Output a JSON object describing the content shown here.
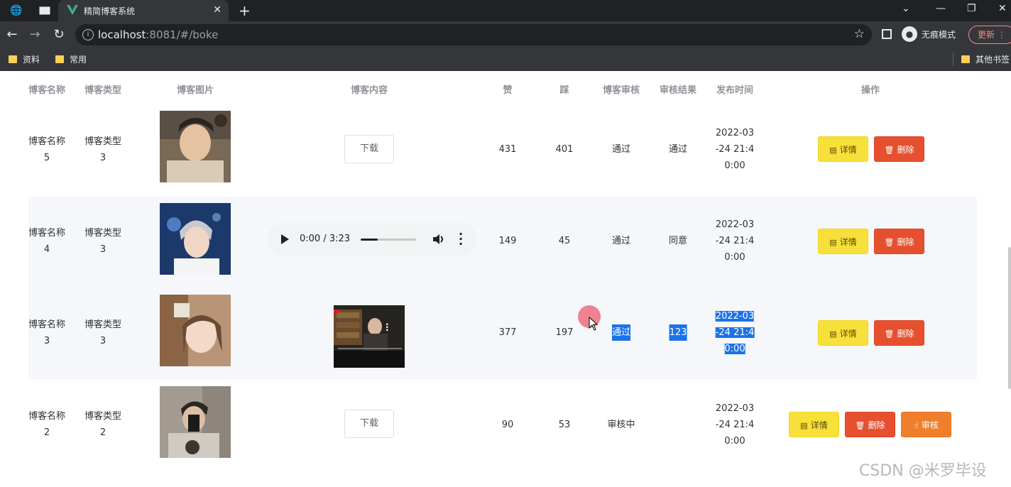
{
  "browser": {
    "tab_title": "精简博客系统",
    "url_host": "localhost",
    "url_rest": ":8081/#/boke",
    "incognito_label": "无痕模式",
    "update_label": "更新",
    "bookmarks": [
      "资料",
      "常用"
    ],
    "other_bookmarks": "其他书签"
  },
  "table": {
    "headers": [
      "博客名称",
      "博客类型",
      "博客图片",
      "博客内容",
      "赞",
      "踩",
      "博客审核",
      "审核结果",
      "发布时间",
      "操作"
    ],
    "rows": [
      {
        "name_line1": "博客名称",
        "name_line2": "5",
        "type_line1": "博客类型",
        "type_line2": "3",
        "content_kind": "download",
        "download_label": "下载",
        "likes": "431",
        "dislikes": "401",
        "review": "通过",
        "result": "通过",
        "time_l1": "2022-03",
        "time_l2": "-24 21:4",
        "time_l3": "0:00",
        "detail_label": "详情",
        "delete_label": "删除"
      },
      {
        "name_line1": "博客名称",
        "name_line2": "4",
        "type_line1": "博客类型",
        "type_line2": "3",
        "content_kind": "audio",
        "audio_time": "0:00 / 3:23",
        "audio_progress": 0.31,
        "likes": "149",
        "dislikes": "45",
        "review": "通过",
        "result": "同意",
        "time_l1": "2022-03",
        "time_l2": "-24 21:4",
        "time_l3": "0:00",
        "detail_label": "详情",
        "delete_label": "删除"
      },
      {
        "name_line1": "博客名称",
        "name_line2": "3",
        "type_line1": "博客类型",
        "type_line2": "3",
        "content_kind": "video",
        "likes": "377",
        "dislikes": "197",
        "review": "通过",
        "result": "123",
        "time_l1": "2022-03",
        "time_l2": "-24 21:4",
        "time_l3": "0:00",
        "detail_label": "详情",
        "delete_label": "删除"
      },
      {
        "name_line1": "博客名称",
        "name_line2": "2",
        "type_line1": "博客类型",
        "type_line2": "2",
        "content_kind": "download",
        "download_label": "下载",
        "likes": "90",
        "dislikes": "53",
        "review": "审核中",
        "result": "",
        "time_l1": "2022-03",
        "time_l2": "-24 21:4",
        "time_l3": "0:00",
        "detail_label": "详情",
        "delete_label": "删除",
        "review_label": "审核"
      }
    ]
  },
  "watermark": "CSDN @米罗毕设",
  "colors": {
    "warning": "#f7e03a",
    "danger": "#e6502e",
    "review": "#f07f2d",
    "selection": "#1a73e8"
  }
}
